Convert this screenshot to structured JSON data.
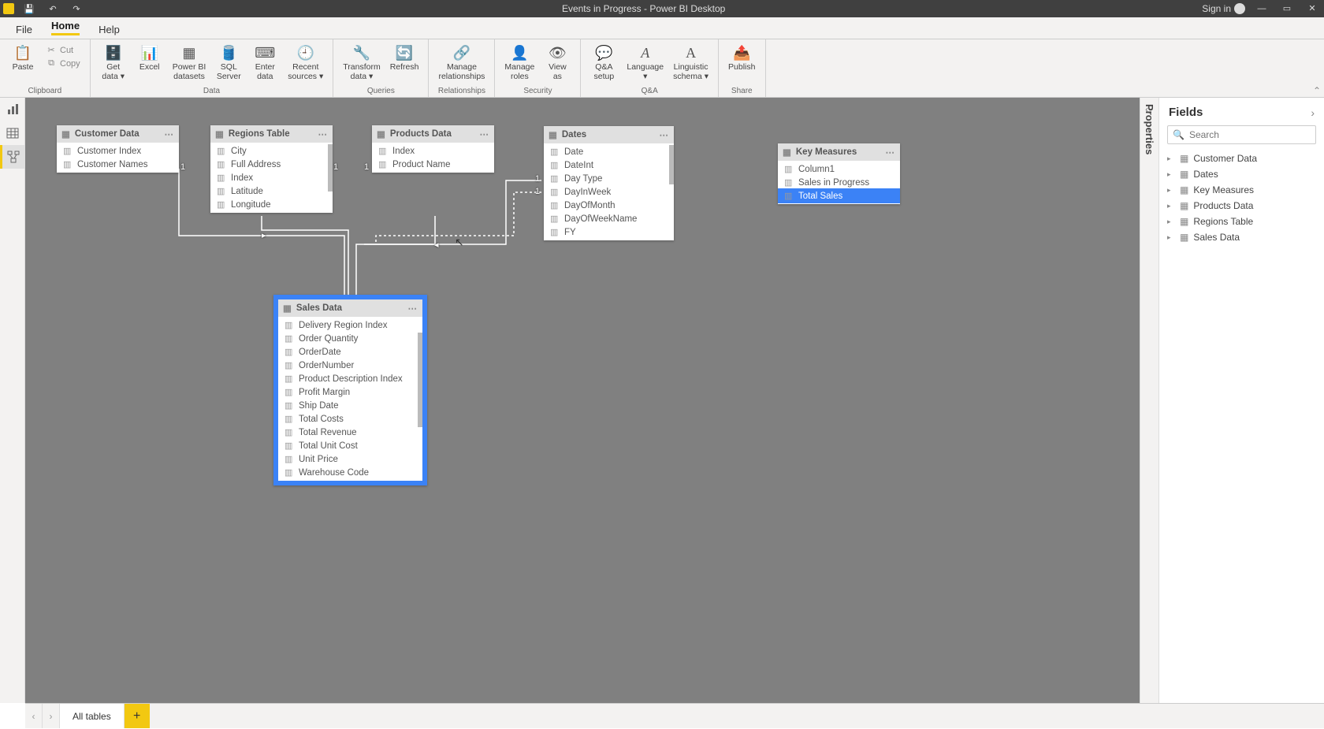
{
  "titlebar": {
    "title": "Events in Progress - Power BI Desktop",
    "signin": "Sign in"
  },
  "tabs": {
    "file": "File",
    "home": "Home",
    "help": "Help"
  },
  "ribbon": {
    "clipboard": {
      "label": "Clipboard",
      "paste": "Paste",
      "cut": "Cut",
      "copy": "Copy"
    },
    "data": {
      "label": "Data",
      "getdata": "Get\ndata ▾",
      "excel": "Excel",
      "pbids": "Power BI\ndatasets",
      "sql": "SQL\nServer",
      "enter": "Enter\ndata",
      "recent": "Recent\nsources ▾"
    },
    "queries": {
      "label": "Queries",
      "transform": "Transform\ndata ▾",
      "refresh": "Refresh"
    },
    "relationships": {
      "label": "Relationships",
      "manage": "Manage\nrelationships"
    },
    "security": {
      "label": "Security",
      "roles": "Manage\nroles",
      "view": "View\nas"
    },
    "qa": {
      "label": "Q&A",
      "setup": "Q&A\nsetup",
      "lang": "Language\n▾",
      "ling": "Linguistic\nschema ▾"
    },
    "share": {
      "label": "Share",
      "publish": "Publish"
    }
  },
  "tables": {
    "customer": {
      "title": "Customer Data",
      "fields": [
        "Customer Index",
        "Customer Names"
      ]
    },
    "regions": {
      "title": "Regions Table",
      "fields": [
        "City",
        "Full Address",
        "Index",
        "Latitude",
        "Longitude"
      ]
    },
    "products": {
      "title": "Products Data",
      "fields": [
        "Index",
        "Product Name"
      ]
    },
    "dates": {
      "title": "Dates",
      "fields": [
        "Date",
        "DateInt",
        "Day Type",
        "DayInWeek",
        "DayOfMonth",
        "DayOfWeekName",
        "FY"
      ]
    },
    "keymeasures": {
      "title": "Key Measures",
      "fields": [
        "Column1",
        "Sales in Progress",
        "Total Sales"
      ]
    },
    "sales": {
      "title": "Sales Data",
      "fields": [
        "Delivery Region Index",
        "Order Quantity",
        "OrderDate",
        "OrderNumber",
        "Product Description Index",
        "Profit Margin",
        "Ship Date",
        "Total Costs",
        "Total Revenue",
        "Total Unit Cost",
        "Unit Price",
        "Warehouse Code"
      ]
    }
  },
  "fields_pane": {
    "title": "Fields",
    "search_placeholder": "Search",
    "tables": [
      "Customer Data",
      "Dates",
      "Key Measures",
      "Products Data",
      "Regions Table",
      "Sales Data"
    ]
  },
  "props_pane": {
    "title": "Properties"
  },
  "bottom": {
    "tab": "All tables"
  }
}
